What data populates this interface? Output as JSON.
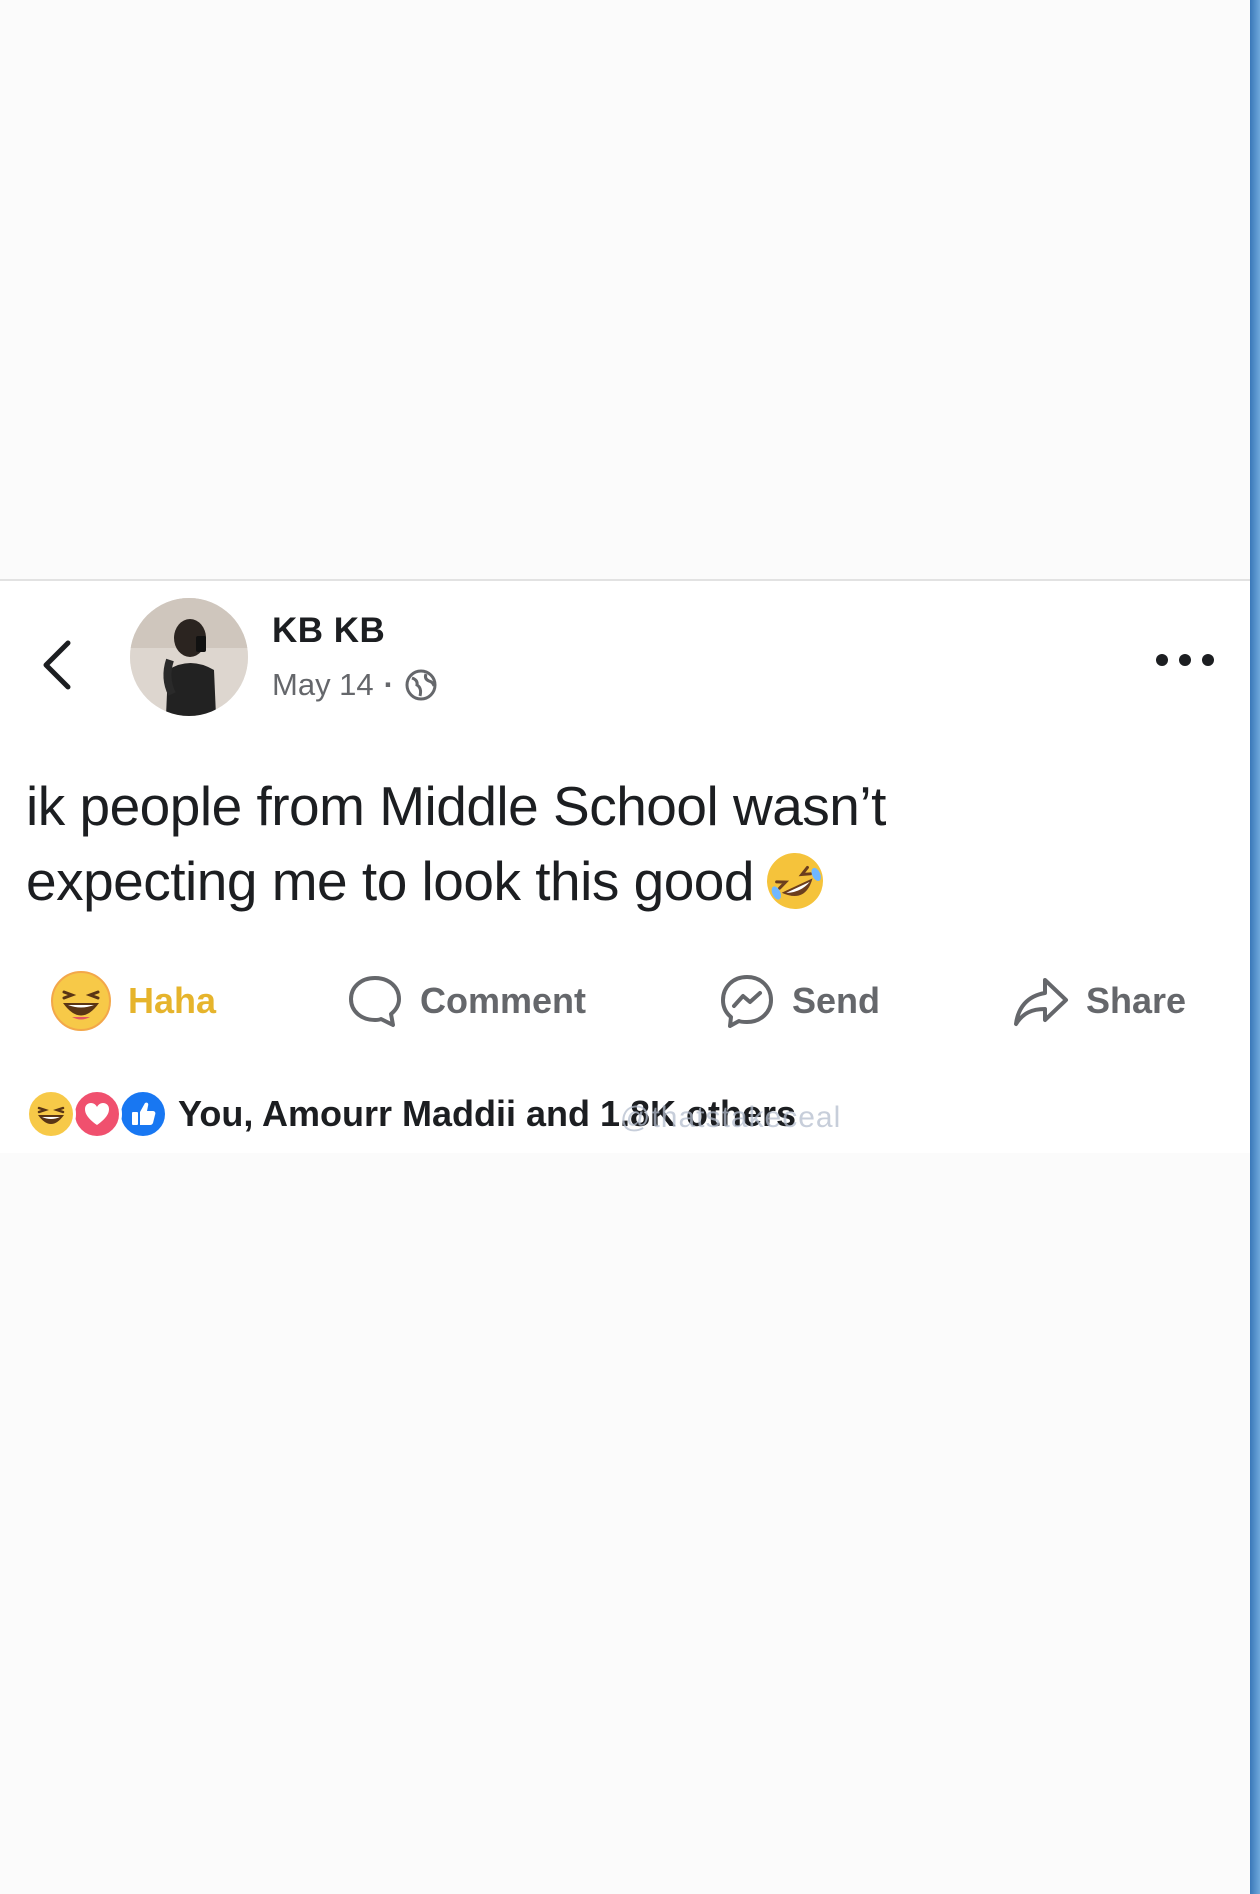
{
  "post": {
    "author": "KB KB",
    "date": "May 14",
    "separator": "·",
    "text_line1": "ik people from Middle School wasn’t",
    "text_line2": "expecting me to look this good"
  },
  "actions": {
    "haha": "Haha",
    "comment": "Comment",
    "send": "Send",
    "share": "Share"
  },
  "reactions": {
    "summary": "You, Amourr Maddii and 1.8K others",
    "icons": [
      "haha-icon",
      "love-icon",
      "like-icon"
    ]
  },
  "watermark": "@thatstakeceal",
  "colors": {
    "haha_accent": "#e6b42c",
    "love": "#f0506e",
    "like": "#1877f2",
    "text_primary": "#1c1e21",
    "text_secondary": "#65676b"
  }
}
